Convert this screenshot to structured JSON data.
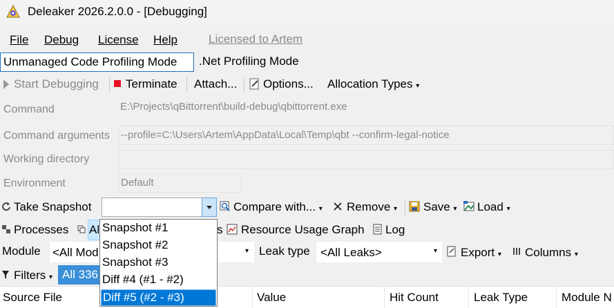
{
  "window": {
    "title": "Deleaker 2026.2.0.0 - [Debugging]"
  },
  "menu": {
    "file": "File",
    "debug": "Debug",
    "license": "License",
    "help": "Help",
    "licensed": "Licensed to Artem"
  },
  "modes": {
    "unmanaged": "Unmanaged Code Profiling Mode",
    "net": ".Net Profiling Mode"
  },
  "toolbar": {
    "start": "Start Debugging",
    "terminate": "Terminate",
    "attach": "Attach...",
    "options": "Options...",
    "alloc_types": "Allocation Types"
  },
  "fields": {
    "command_label": "Command",
    "command_value": "E:\\Projects\\qBittorrent\\build-debug\\qbittorrent.exe",
    "args_label": "Command arguments",
    "args_value": "--profile=C:\\Users\\Artem\\AppData\\Local\\Temp\\qbt --confirm-legal-notice",
    "workdir_label": "Working directory",
    "workdir_value": "",
    "env_label": "Environment",
    "env_value": "Default"
  },
  "snapshot_bar": {
    "take": "Take Snapshot",
    "compare": "Compare with...",
    "remove": "Remove",
    "save": "Save",
    "load": "Load"
  },
  "tabs": {
    "processes": "Processes",
    "allocations_partial": "Al",
    "hidden_tail": "s",
    "resource_graph": "Resource Usage Graph",
    "log": "Log"
  },
  "module_row": {
    "module_label": "Module",
    "module_value": "<All Mod",
    "leak_label": "Leak type",
    "leak_value": "<All Leaks>",
    "export": "Export",
    "columns": "Columns"
  },
  "filters": {
    "label": "Filters",
    "all": "All 336"
  },
  "table_header": [
    "Source File",
    "Value",
    "Hit Count",
    "Leak Type",
    "Module N"
  ],
  "dropdown": {
    "items": [
      "Snapshot #1",
      "Snapshot #2",
      "Snapshot #3",
      "Diff #4 (#1 - #2)",
      "Diff #5 (#2 - #3)"
    ],
    "selected_index": 4
  },
  "colors": {
    "accent": "#0078d7",
    "selection": "#3a8fd8",
    "stop": "#e81123"
  }
}
